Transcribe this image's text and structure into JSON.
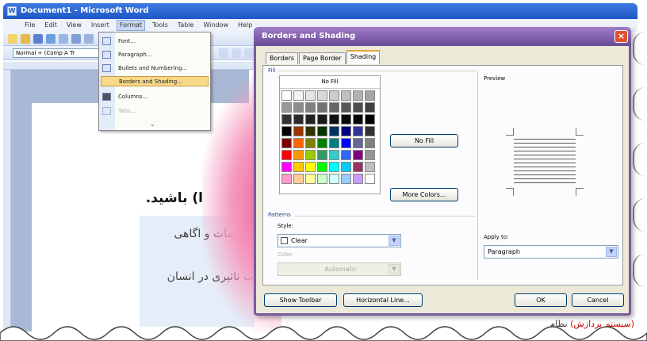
{
  "window": {
    "title": "Document1 - Microsoft Word"
  },
  "menubar": {
    "items": [
      "File",
      "Edit",
      "View",
      "Insert",
      "Format",
      "Tools",
      "Table",
      "Window",
      "Help"
    ]
  },
  "toolbar": {
    "style_value": "Normal + (Comp A Tr"
  },
  "format_menu": {
    "items": [
      {
        "label": "Font...",
        "icon": "font-icon"
      },
      {
        "label": "Paragraph...",
        "icon": "paragraph-icon"
      },
      {
        "label": "Bullets and Numbering...",
        "icon": "bullets-icon"
      },
      {
        "label": "Borders and Shading...",
        "icon": "borders-icon",
        "highlighted": true
      },
      {
        "label": "Columns...",
        "icon": "columns-icon"
      },
      {
        "label": "Tabs...",
        "icon": "tabs-icon",
        "disabled": true
      }
    ]
  },
  "document": {
    "heading": "ا) باشید.",
    "line1": "معلومات و اگاهی",
    "line2": "ت تاثیری در انسان",
    "footer_red": "(سیستم پردازش)",
    "footer_plain": "نظام"
  },
  "dialog": {
    "title": "Borders and Shading",
    "tabs": [
      {
        "label": "Borders",
        "active": false
      },
      {
        "label": "Page Border",
        "active": false
      },
      {
        "label": "Shading",
        "active": true
      }
    ],
    "fill": {
      "group_label": "Fill",
      "no_fill_strip": "No Fill",
      "no_fill_button": "No Fill",
      "more_colors_button": "More Colors...",
      "swatches": [
        "#ffffff",
        "#f2f2f2",
        "#e6e6e6",
        "#d9d9d9",
        "#cccccc",
        "#bfbfbf",
        "#b3b3b3",
        "#a6a6a6",
        "#999999",
        "#8c8c8c",
        "#808080",
        "#737373",
        "#666666",
        "#595959",
        "#4d4d4d",
        "#404040",
        "#333333",
        "#2a2a2a",
        "#222222",
        "#1a1a1a",
        "#111111",
        "#0a0a0a",
        "#050505",
        "#000000",
        "#000000",
        "#993300",
        "#333300",
        "#003300",
        "#003366",
        "#000080",
        "#333399",
        "#333333",
        "#800000",
        "#ff6600",
        "#808000",
        "#008000",
        "#008080",
        "#0000ff",
        "#666699",
        "#808080",
        "#ff0000",
        "#ff9900",
        "#99cc00",
        "#339966",
        "#33cccc",
        "#3366ff",
        "#800080",
        "#969696",
        "#ff00ff",
        "#ffcc00",
        "#ffff00",
        "#00ff00",
        "#00ffff",
        "#00ccff",
        "#993366",
        "#c0c0c0",
        "#ff99cc",
        "#ffcc99",
        "#ffff99",
        "#ccffcc",
        "#ccffff",
        "#99ccff",
        "#cc99ff",
        "#ffffff"
      ]
    },
    "patterns": {
      "group_label": "Patterns",
      "style_label": "Style:",
      "style_value": "Clear",
      "color_label": "Color:",
      "color_value": "Automatic"
    },
    "preview": {
      "label": "Preview"
    },
    "apply_to": {
      "label": "Apply to:",
      "value": "Paragraph"
    },
    "buttons": {
      "show_toolbar": "Show Toolbar",
      "horizontal_line": "Horizontal Line...",
      "ok": "OK",
      "cancel": "Cancel"
    }
  },
  "colors": {
    "dialog_frame": "#7a5a9e",
    "menu_highlight": "#f7d989",
    "swoosh": "#e94a8f"
  }
}
